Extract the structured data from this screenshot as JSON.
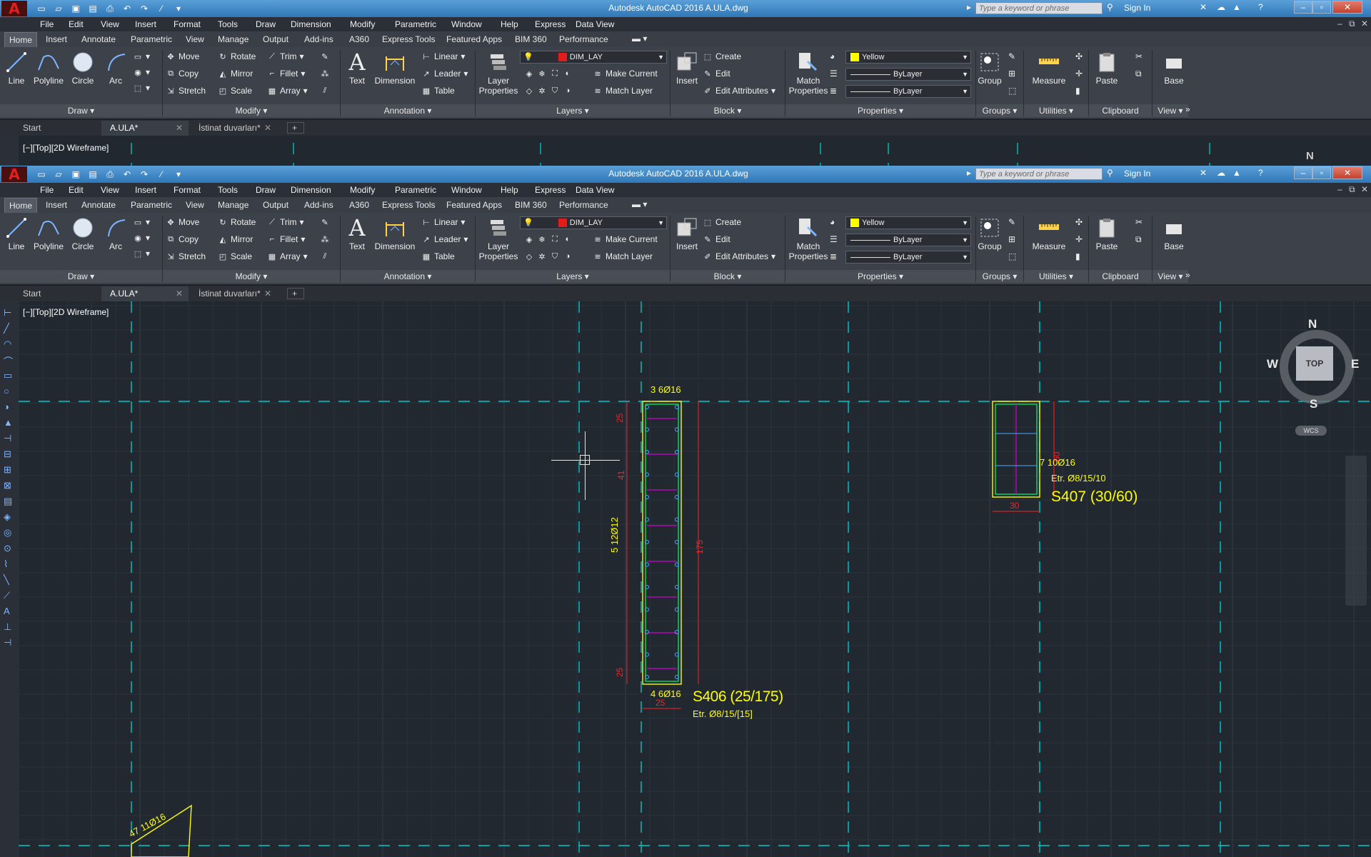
{
  "window": {
    "title": "Autodesk AutoCAD 2016    A.ULA.dwg",
    "search_placeholder": "Type a keyword or phrase",
    "sign_in": "Sign In"
  },
  "menu": [
    "File",
    "Edit",
    "View",
    "Insert",
    "Format",
    "Tools",
    "Draw",
    "Dimension",
    "Modify",
    "Parametric",
    "Window",
    "Help",
    "Express",
    "Data View"
  ],
  "ribbon_tabs": [
    "Home",
    "Insert",
    "Annotate",
    "Parametric",
    "View",
    "Manage",
    "Output",
    "Add-ins",
    "A360",
    "Express Tools",
    "Featured Apps",
    "BIM 360",
    "Performance"
  ],
  "ribbon": {
    "draw": {
      "line": "Line",
      "polyline": "Polyline",
      "circle": "Circle",
      "arc": "Arc",
      "label": "Draw"
    },
    "modify": {
      "move": "Move",
      "rotate": "Rotate",
      "trim": "Trim",
      "copy": "Copy",
      "mirror": "Mirror",
      "fillet": "Fillet",
      "stretch": "Stretch",
      "scale": "Scale",
      "array": "Array",
      "label": "Modify"
    },
    "annotation": {
      "text": "Text",
      "dimension": "Dimension",
      "linear": "Linear",
      "leader": "Leader",
      "table": "Table",
      "label": "Annotation"
    },
    "layers": {
      "layer_properties_1": "Layer",
      "layer_properties_2": "Properties",
      "current_layer": "DIM_LAY",
      "make_current": "Make Current",
      "match_layer": "Match Layer",
      "label": "Layers"
    },
    "block": {
      "insert": "Insert",
      "create": "Create",
      "edit": "Edit",
      "edit_attributes": "Edit Attributes",
      "label": "Block"
    },
    "properties": {
      "match_1": "Match",
      "match_2": "Properties",
      "color": "Yellow",
      "linetype": "ByLayer",
      "lineweight": "ByLayer",
      "label": "Properties"
    },
    "groups": {
      "group": "Group",
      "label": "Groups"
    },
    "utilities": {
      "measure": "Measure",
      "label": "Utilities"
    },
    "clipboard": {
      "paste": "Paste",
      "label": "Clipboard"
    },
    "view": {
      "base": "Base",
      "label": "View"
    }
  },
  "doc_tabs": [
    {
      "label": "Start"
    },
    {
      "label": "A.ULA*",
      "active": true
    },
    {
      "label": "İstinat duvarları*"
    }
  ],
  "viewport": {
    "label": "[−][Top][2D Wireframe]",
    "viewcube": {
      "n": "N",
      "s": "S",
      "e": "E",
      "w": "W",
      "top": "TOP",
      "wcs": "WCS"
    }
  },
  "drawing": {
    "s406": {
      "name": "S406  (25/175)",
      "stirrup": "Etr. Ø8/15/[15]",
      "top_bar": "3  6Ø16",
      "bottom_bar": "4  6Ø16",
      "side_bar": "5 12Ø12",
      "width": "25",
      "height": "175",
      "end_zone": "25",
      "mid": "41"
    },
    "s407": {
      "name": "S407  (30/60)",
      "stirrup": "Etr. Ø8/15/10",
      "bar": "7  10Ø16",
      "width": "30",
      "height": "60"
    },
    "s_corner": {
      "bar": "47  11Ø16"
    }
  },
  "colors": {
    "title_bar": "#3f86c8",
    "ribbon": "#3d424a",
    "canvas": "#212830",
    "annotation_yellow": "#ffff00",
    "dim_red": "#ff2020",
    "axis_cyan": "#00c8c8",
    "stirrup_magenta": "#d000d0",
    "outline_green": "#00ff66"
  }
}
